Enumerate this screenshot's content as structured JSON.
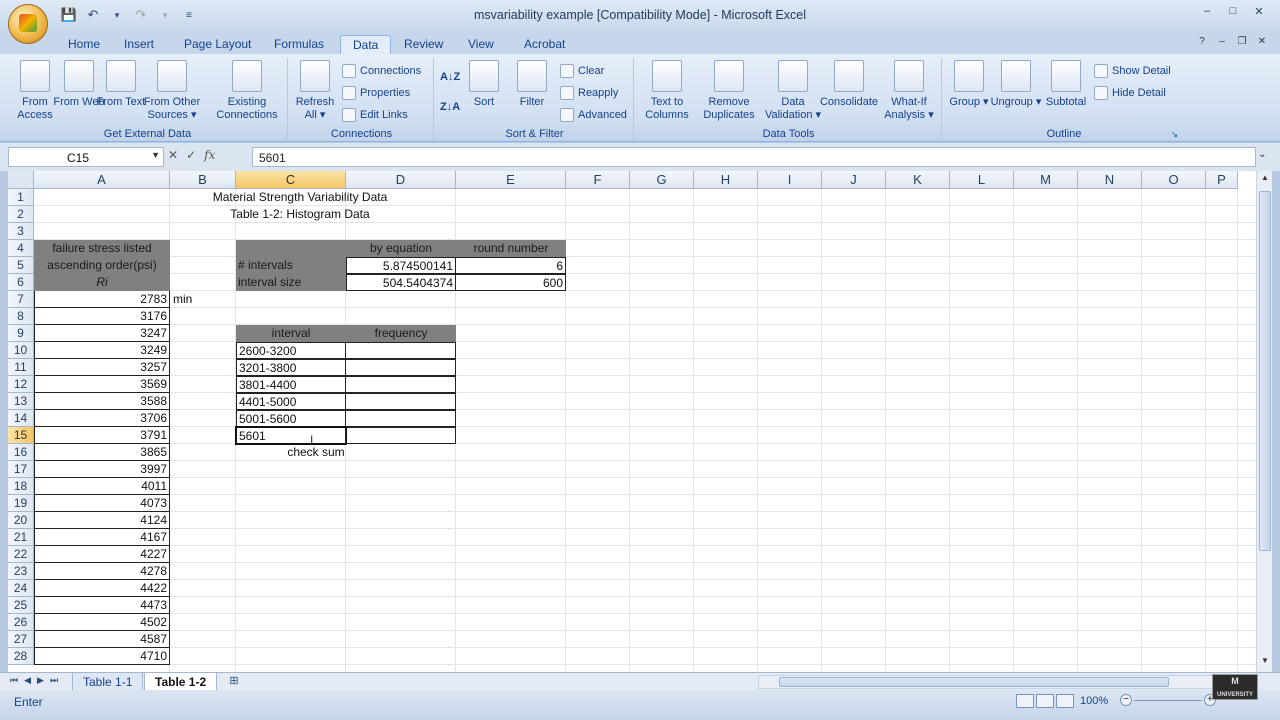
{
  "window": {
    "title": "msvariability example  [Compatibility Mode] - Microsoft Excel",
    "controls": [
      "–",
      "□",
      "✕"
    ]
  },
  "ribbon": {
    "tabs": [
      "Home",
      "Insert",
      "Page Layout",
      "Formulas",
      "Data",
      "Review",
      "View",
      "Acrobat"
    ],
    "active_tab": "Data",
    "groups": {
      "get_external": {
        "label": "Get External Data",
        "buttons": [
          "From Access",
          "From Web",
          "From Text",
          "From Other Sources ▾",
          "Existing Connections"
        ]
      },
      "connections": {
        "label": "Connections",
        "refresh": "Refresh All ▾",
        "small": [
          "Connections",
          "Properties",
          "Edit Links"
        ]
      },
      "sort_filter": {
        "label": "Sort & Filter",
        "sort": "Sort",
        "filter": "Filter",
        "small": [
          "Clear",
          "Reapply",
          "Advanced"
        ]
      },
      "data_tools": {
        "label": "Data Tools",
        "buttons": [
          "Text to Columns",
          "Remove Duplicates",
          "Data Validation ▾",
          "Consolidate",
          "What-If Analysis ▾"
        ]
      },
      "outline": {
        "label": "Outline",
        "buttons": [
          "Group ▾",
          "Ungroup ▾",
          "Subtotal"
        ],
        "small": [
          "Show Detail",
          "Hide Detail"
        ]
      }
    }
  },
  "formula_bar": {
    "name_box": "C15",
    "formula": "5601",
    "fx": "fx"
  },
  "grid": {
    "columns": [
      "A",
      "B",
      "C",
      "D",
      "E",
      "F",
      "G",
      "H",
      "I",
      "J",
      "K",
      "L",
      "M",
      "N",
      "O",
      "P"
    ],
    "rows": [
      "1",
      "2",
      "3",
      "4",
      "5",
      "6",
      "7",
      "8",
      "9",
      "10",
      "11",
      "12",
      "13",
      "14",
      "15",
      "16",
      "17",
      "18",
      "19",
      "20",
      "21",
      "22",
      "23",
      "24",
      "25",
      "26",
      "27",
      "28"
    ],
    "selected_column": "C",
    "selected_row": "15",
    "title1": "Material Strength Variability Data",
    "title2": "Table 1-2: Histogram Data",
    "a_header": [
      "failure stress listed",
      "ascending order(psi)",
      "Ri"
    ],
    "a_values": [
      "2783",
      "3176",
      "3247",
      "3249",
      "3257",
      "3569",
      "3588",
      "3706",
      "3791",
      "3865",
      "3997",
      "4011",
      "4073",
      "4124",
      "4167",
      "4227",
      "4278",
      "4422",
      "4473",
      "4502",
      "4587",
      "4710"
    ],
    "b7": "min",
    "d4": "by equation",
    "e4": "round number",
    "c5": "# intervals",
    "d5": "5.874500141",
    "e5": "6",
    "c6": "interval size",
    "d6": "504.5404374",
    "e6": "600",
    "c9": "interval",
    "d9": "frequency",
    "intervals": [
      "2600-3200",
      "3201-3800",
      "3801-4400",
      "4401-5000",
      "5001-5600",
      "5601"
    ],
    "c16": "check sum"
  },
  "sheets": {
    "tabs": [
      "Table 1-1",
      "Table 1-2"
    ],
    "active": "Table 1-2"
  },
  "status": {
    "mode": "Enter",
    "zoom": "100%"
  },
  "watermark": "UNIVERSITY"
}
